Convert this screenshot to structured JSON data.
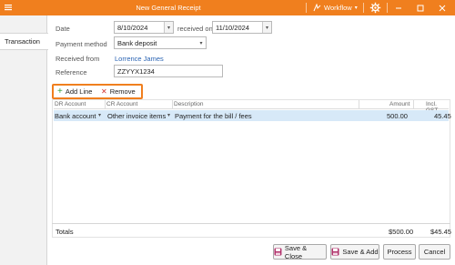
{
  "window": {
    "title": "New General Receipt",
    "workflow_label": "Workflow",
    "brand_color": "#f07f1e"
  },
  "tabs": [
    {
      "label": "Transaction",
      "active": true
    }
  ],
  "form": {
    "date_label": "Date",
    "date_value": "8/10/2024",
    "received_on_label": "received on",
    "received_on_value": "11/10/2024",
    "payment_method_label": "Payment method",
    "payment_method_value": "Bank deposit",
    "received_from_label": "Received from",
    "received_from_value": "Lorrence James",
    "reference_label": "Reference",
    "reference_value": "ZZYYX1234"
  },
  "actions": {
    "add_line": "Add Line",
    "remove": "Remove"
  },
  "grid": {
    "columns": {
      "dr_account": "DR Account",
      "cr_account": "CR Account",
      "description": "Description",
      "amount": "Amount",
      "incl_gst": "Incl. GST"
    },
    "rows": [
      {
        "dr_account": "Bank account",
        "cr_account": "Other invoice items",
        "description": "Payment for the bill / fees",
        "amount": "500.00",
        "incl_gst": "45.45"
      }
    ]
  },
  "totals": {
    "label": "Totals",
    "amount": "$500.00",
    "gst": "$45.45"
  },
  "footer": {
    "save_close": "Save & Close",
    "save_add": "Save & Add",
    "process": "Process",
    "cancel": "Cancel"
  }
}
